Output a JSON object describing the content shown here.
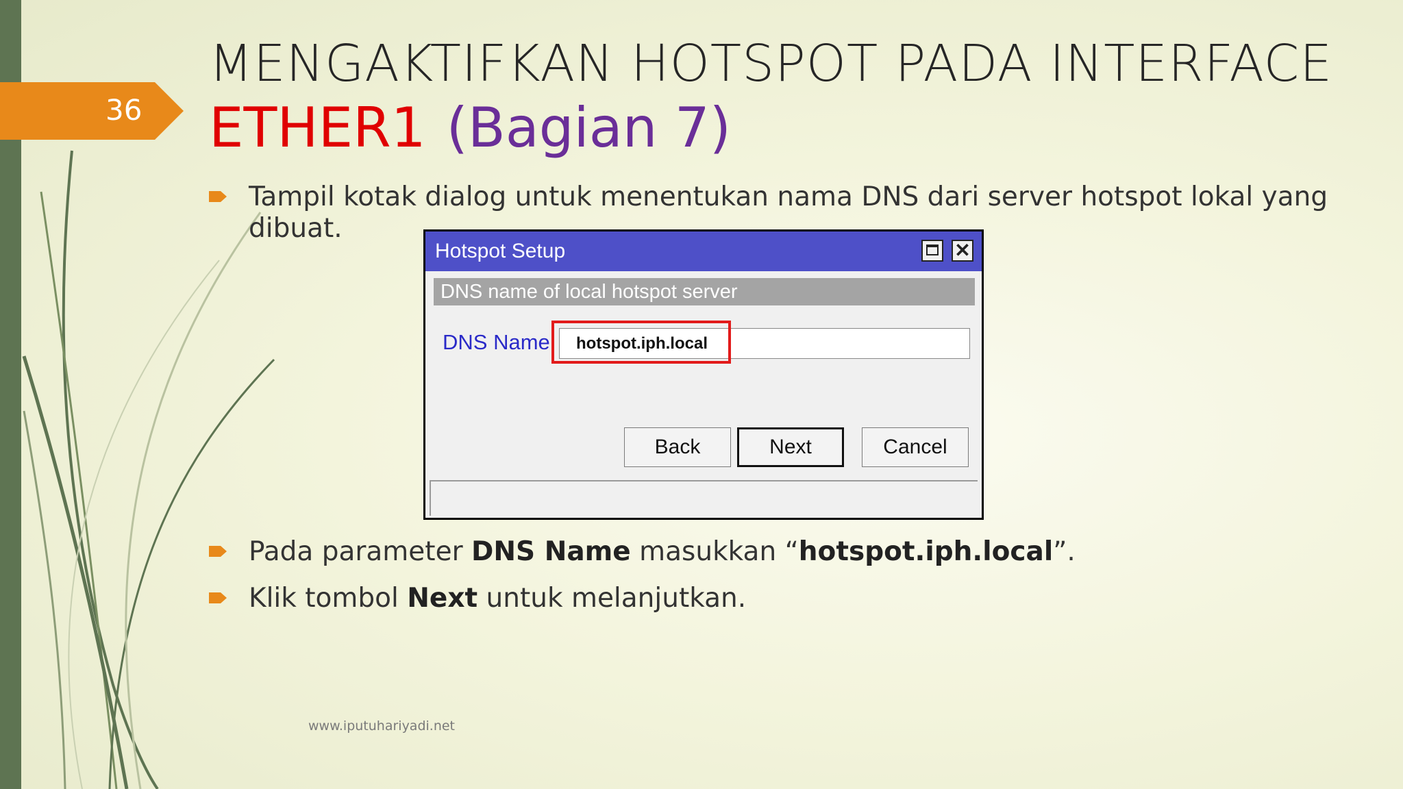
{
  "slide": {
    "number": "36",
    "title_line1": "MENGAKTIFKAN HOTSPOT PADA INTERFACE",
    "title_line2_red": "ETHER1",
    "title_line2_purple": "(Bagian 7)",
    "bullets": [
      {
        "line1": "Tampil kotak dialog untuk menentukan nama DNS dari server hotspot lokal yang",
        "line2": "dibuat."
      },
      {
        "pre": "Pada parameter ",
        "b1": "DNS Name",
        "mid": " masukkan “",
        "b2": "hotspot.iph.local",
        "post": "”."
      },
      {
        "pre": "Klik tombol ",
        "b1": "Next",
        "post": " untuk melanjutkan."
      }
    ],
    "footer": "www.iputuhariyadi.net"
  },
  "dialog": {
    "title": "Hotspot Setup",
    "close_glyph": "✕",
    "section_header": "DNS name of local hotspot server",
    "dns_label": "DNS Name:",
    "dns_value": "hotspot.iph.local",
    "back_label": "Back",
    "next_label": "Next",
    "cancel_label": "Cancel"
  },
  "colors": {
    "accent_orange": "#e8891a",
    "sidebar_green": "#5e7452",
    "title_red": "#e00000",
    "title_purple": "#6a2e98",
    "dialog_titlebar": "#4e50c8",
    "highlight_red": "#e21b1b"
  }
}
